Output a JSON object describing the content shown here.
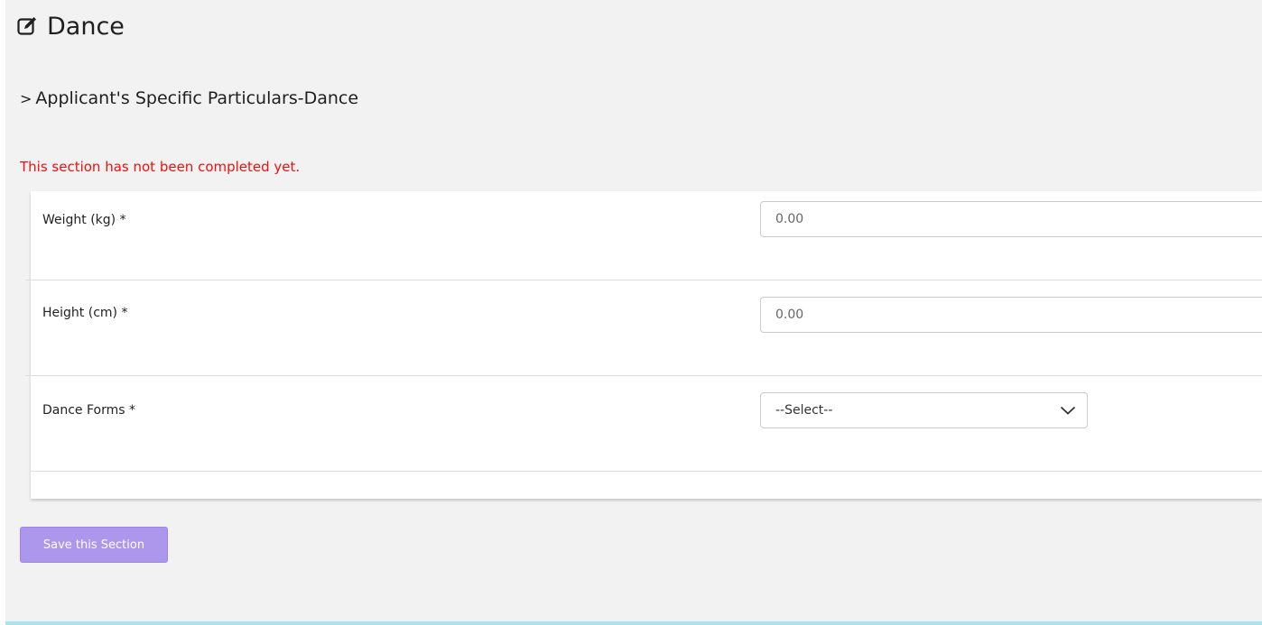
{
  "header": {
    "title": "Dance",
    "icon": "edit-icon"
  },
  "section": {
    "heading_prefix": ">",
    "heading": "Applicant's Specific Particulars-Dance",
    "status": "This section has not been completed yet.",
    "status_color": "#ee1111"
  },
  "form": {
    "weight": {
      "label": "Weight (kg) *",
      "placeholder": "0.00"
    },
    "height": {
      "label": "Height (cm) *",
      "placeholder": "0.00"
    },
    "dance_forms": {
      "label": "Dance Forms *",
      "selected": "--Select--"
    }
  },
  "actions": {
    "save_label": "Save this Section",
    "save_color": "#ad97ed"
  }
}
